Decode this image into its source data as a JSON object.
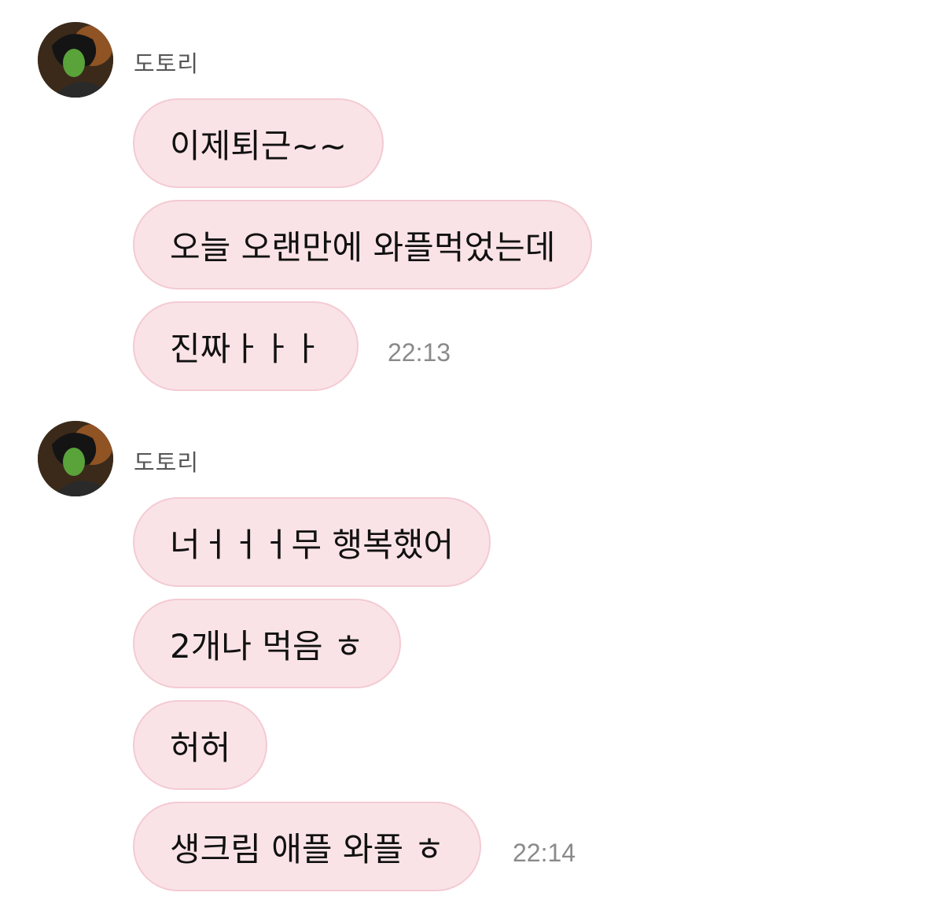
{
  "messages": [
    {
      "sender": "도토리",
      "bubbles": [
        "이제퇴근~~",
        "오늘 오랜만에 와플먹었는데",
        "진짜ㅏㅏㅏ"
      ],
      "time": "22:13"
    },
    {
      "sender": "도토리",
      "bubbles": [
        "너ㅓㅓㅓ무 행복했어",
        "2개나 먹음 ㅎ",
        "허허",
        "생크림 애플 와플 ㅎ"
      ],
      "time": "22:14"
    }
  ]
}
